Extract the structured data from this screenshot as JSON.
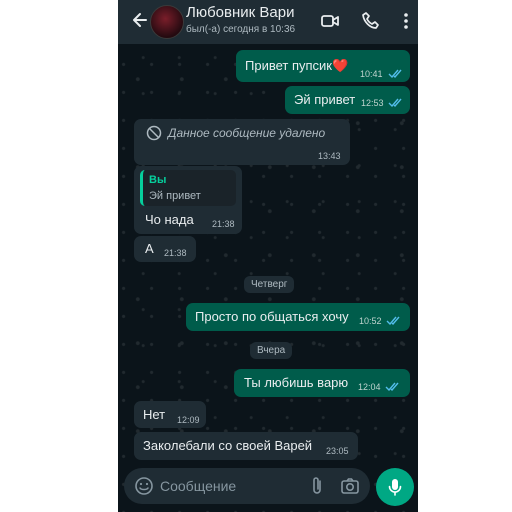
{
  "header": {
    "contact_name": "Любовник Вари",
    "status": "был(-а) сегодня в 10:36"
  },
  "messages": [
    {
      "kind": "out",
      "text": "Привет пупсик❤️",
      "time": "10:41"
    },
    {
      "kind": "out",
      "text": "Эй привет",
      "time": "12:53"
    },
    {
      "kind": "deleted",
      "text": "Данное сообщение удалено",
      "time": "13:43"
    },
    {
      "kind": "reply",
      "quote_author": "Вы",
      "quote_text": "Эй привет",
      "text": "Чо нада",
      "time": "21:38"
    },
    {
      "kind": "in",
      "text": "А",
      "time": "21:38"
    },
    {
      "kind": "out",
      "text": "Просто по общаться хочу",
      "time": "10:52"
    },
    {
      "kind": "out",
      "text": "Ты любишь варю",
      "time": "12:04"
    },
    {
      "kind": "in",
      "text": "Нет",
      "time": "12:09"
    },
    {
      "kind": "in",
      "text": "Заколебали со своей Варей",
      "time": "23:05"
    }
  ],
  "dates": [
    "Четверг",
    "Вчера"
  ],
  "input": {
    "placeholder": "Сообщение"
  },
  "colors": {
    "outgoing_bubble": "#005c4b",
    "incoming_bubble": "#1f2c34",
    "read_ticks": "#53bdeb",
    "accent": "#00a884"
  },
  "icons": [
    "back-arrow-icon",
    "video-call-icon",
    "phone-icon",
    "menu-dots-icon",
    "deleted-icon",
    "emoji-icon",
    "attach-icon",
    "camera-icon",
    "mic-icon"
  ]
}
